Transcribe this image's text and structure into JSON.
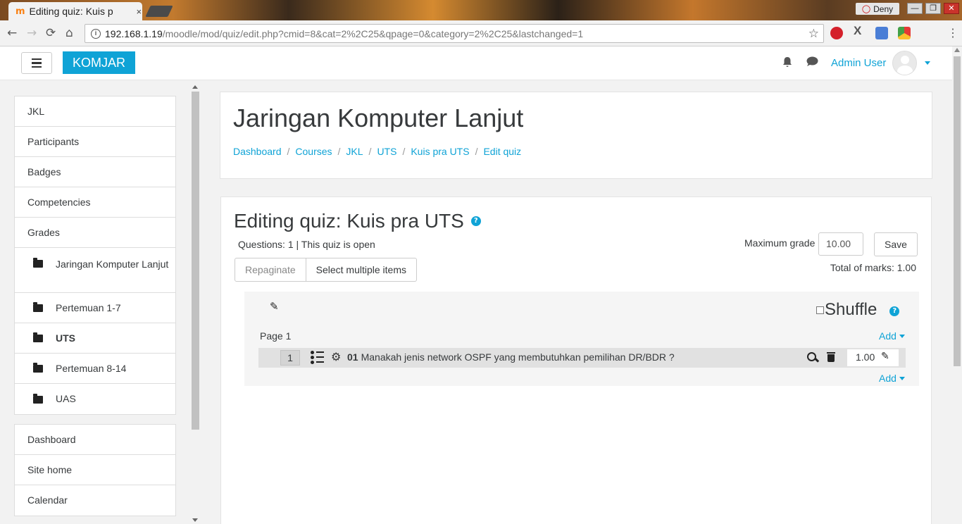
{
  "browser": {
    "tab_title": "Editing quiz: Kuis p",
    "tab_close": "×",
    "url_host": "192.168.1.19",
    "url_path": "/moodle/mod/quiz/edit.php?cmid=8&cat=2%2C25&qpage=0&category=2%2C25&lastchanged=1",
    "profile_name": "Deny",
    "back": "←",
    "forward": "→",
    "reload": "⟳",
    "home": "⌂",
    "star": "☆",
    "menu": "⋮",
    "minimize": "—",
    "restore": "❐",
    "close": "✕",
    "favicon": "m",
    "ext_x": "X"
  },
  "navbar": {
    "brand": "KOMJAR",
    "user_name": "Admin User",
    "bell": "🔔",
    "chat": "💬"
  },
  "drawer": {
    "course_nav": [
      {
        "label": "JKL"
      },
      {
        "label": "Participants"
      },
      {
        "label": "Badges"
      },
      {
        "label": "Competencies"
      },
      {
        "label": "Grades"
      },
      {
        "label": "Jaringan Komputer Lanjut"
      },
      {
        "label": "Pertemuan 1-7"
      },
      {
        "label": "UTS"
      },
      {
        "label": "Pertemuan 8-14"
      },
      {
        "label": "UAS"
      }
    ],
    "site_nav": [
      {
        "label": "Dashboard"
      },
      {
        "label": "Site home"
      },
      {
        "label": "Calendar"
      }
    ]
  },
  "header": {
    "course_title": "Jaringan Komputer Lanjut",
    "breadcrumb": [
      "Dashboard",
      "Courses",
      "JKL",
      "UTS",
      "Kuis pra UTS",
      "Edit quiz"
    ],
    "separator": "/"
  },
  "quiz": {
    "title": "Editing quiz: Kuis pra UTS",
    "help": "?",
    "status": "Questions: 1 | This quiz is open",
    "max_grade_label": "Maximum grade",
    "max_grade_value": "10.00",
    "save_label": "Save",
    "total_marks": "Total of marks: 1.00",
    "repaginate_label": "Repaginate",
    "select_multiple_label": "Select multiple items",
    "section_edit": "✎",
    "shuffle_label": "Shuffle",
    "page_label": "Page 1",
    "add_label": "Add",
    "slot": {
      "number": "1",
      "gear": "⚙",
      "question_name": "01",
      "question_text": "Manakah jenis network OSPF yang membutuhkan pemilihan DR/BDR ?",
      "mark": "1.00",
      "mark_edit": "✎"
    }
  }
}
